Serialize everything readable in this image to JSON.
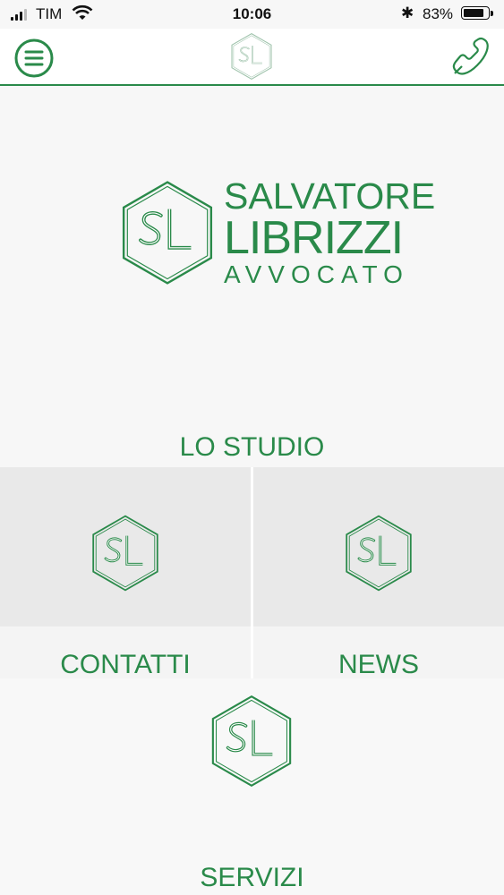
{
  "status_bar": {
    "carrier": "TIM",
    "time": "10:06",
    "battery_percent": "83%",
    "battery_level": 0.83,
    "bluetooth_glyph": "✱"
  },
  "nav": {
    "menu_icon": "hamburger-menu-icon",
    "logo_icon": "sl-hexagon-logo",
    "phone_icon": "phone-icon"
  },
  "hero": {
    "name_line1": "SALVATORE",
    "name_line2": "LIBRIZZI",
    "subtitle": "AVVOCATO"
  },
  "tiles": {
    "lo_studio": "LO STUDIO",
    "contatti": "CONTATTI",
    "news": "NEWS",
    "servizi": "SERVIZI"
  },
  "colors": {
    "brand_green": "#2a8a4a",
    "tile_gray": "#e9e9e9",
    "background": "#f7f7f7"
  }
}
